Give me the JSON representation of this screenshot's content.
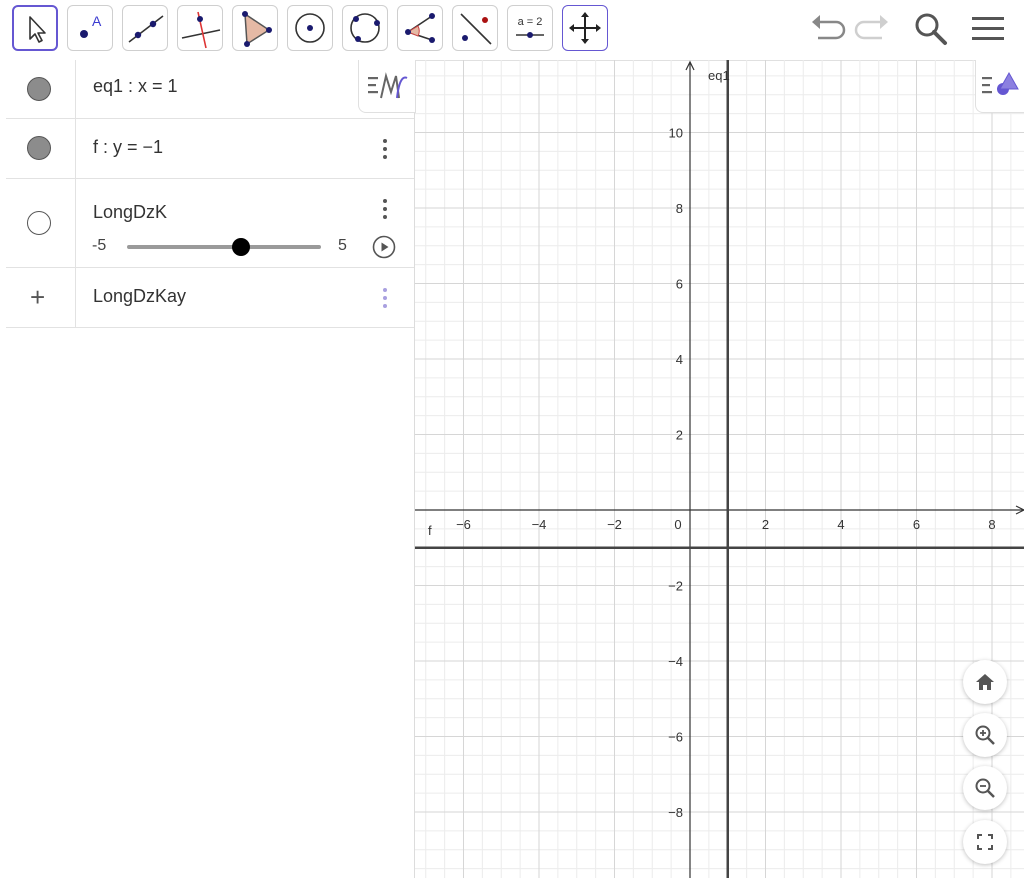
{
  "toolbar": {
    "tools": [
      {
        "name": "move-tool"
      },
      {
        "name": "point-tool"
      },
      {
        "name": "line-tool"
      },
      {
        "name": "perpendicular-line-tool"
      },
      {
        "name": "polygon-tool"
      },
      {
        "name": "circle-center-point-tool"
      },
      {
        "name": "circle-three-points-tool"
      },
      {
        "name": "angle-tool"
      },
      {
        "name": "reflect-tool"
      },
      {
        "name": "slider-tool",
        "label": "a = 2"
      },
      {
        "name": "move-graphics-view-tool"
      }
    ],
    "right": [
      "undo-icon",
      "redo-icon",
      "search-icon",
      "menu-icon"
    ]
  },
  "algebra": {
    "rows": [
      {
        "expr": "eq1 : x = 1",
        "visible": true
      },
      {
        "expr": "f : y = −1",
        "visible": true
      },
      {
        "name": "LongDzK",
        "visible": false,
        "slider": {
          "min": "-5",
          "max": "5",
          "value_fraction": 0.59
        }
      },
      {
        "input": "LongDzKay"
      }
    ]
  },
  "graphics": {
    "labels": {
      "y_axis_object": "eq1",
      "horizontal_line": "f"
    },
    "x_ticks": [
      "−6",
      "−4",
      "−2",
      "0",
      "2",
      "4",
      "6",
      "8"
    ],
    "y_ticks": [
      "10",
      "8",
      "6",
      "4",
      "2",
      "−2",
      "−4",
      "−6",
      "−8"
    ]
  },
  "colors": {
    "accent": "#6557d2",
    "grid_minor": "#ececec",
    "grid_major": "#d6d6d6"
  }
}
